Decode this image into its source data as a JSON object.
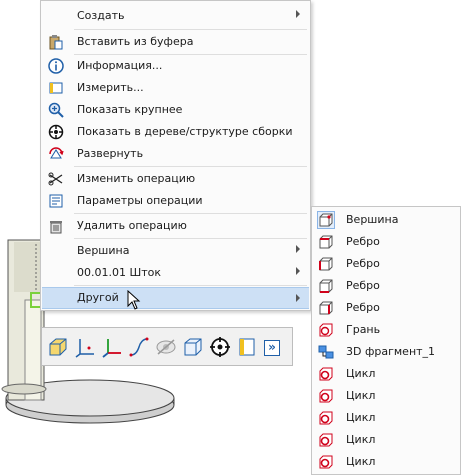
{
  "context_menu": {
    "items": [
      {
        "label": "Создать",
        "icon": "create-icon",
        "submenu": true
      },
      {
        "label": "Вставить из буфера",
        "icon": "paste-icon"
      },
      {
        "label": "Информация...",
        "icon": "info-icon"
      },
      {
        "label": "Измерить...",
        "icon": "measure-icon"
      },
      {
        "label": "Показать крупнее",
        "icon": "zoom-in-icon"
      },
      {
        "label": "Показать в дереве/структуре сборки",
        "icon": "show-in-tree-icon"
      },
      {
        "label": "Развернуть",
        "icon": "rotate-icon"
      },
      {
        "label": "Изменить операцию",
        "icon": "edit-operation-icon"
      },
      {
        "label": "Параметры операции",
        "icon": "operation-params-icon"
      },
      {
        "label": "Удалить операцию",
        "icon": "trash-icon"
      },
      {
        "label": "Вершина",
        "submenu": true
      },
      {
        "label": "00.01.01 Шток",
        "submenu": true
      },
      {
        "label": "Другой",
        "submenu": true,
        "highlighted": true
      }
    ]
  },
  "submenu": {
    "items": [
      {
        "label": "Вершина",
        "icon": "vertex-icon"
      },
      {
        "label": "Ребро",
        "icon": "edge-icon"
      },
      {
        "label": "Ребро",
        "icon": "edge-icon"
      },
      {
        "label": "Ребро",
        "icon": "edge-icon"
      },
      {
        "label": "Ребро",
        "icon": "edge-icon"
      },
      {
        "label": "Грань",
        "icon": "face-icon"
      },
      {
        "label": "3D фрагмент_1",
        "icon": "fragment-icon"
      },
      {
        "label": "Цикл",
        "icon": "loop-icon"
      },
      {
        "label": "Цикл",
        "icon": "loop-icon"
      },
      {
        "label": "Цикл",
        "icon": "loop-icon"
      },
      {
        "label": "Цикл",
        "icon": "loop-icon"
      },
      {
        "label": "Цикл",
        "icon": "loop-icon"
      }
    ]
  },
  "toolbar": {
    "buttons": [
      "solid-icon",
      "axes-icon",
      "coordinate-system-icon",
      "curve-icon",
      "hide-icon",
      "box-icon",
      "target-icon",
      "ruler-icon",
      "more-icon"
    ],
    "more_label": "»"
  },
  "colors": {
    "highlight": "#cde0f5",
    "accent_red": "#d0021b",
    "icon_blue": "#1f5fa8"
  }
}
